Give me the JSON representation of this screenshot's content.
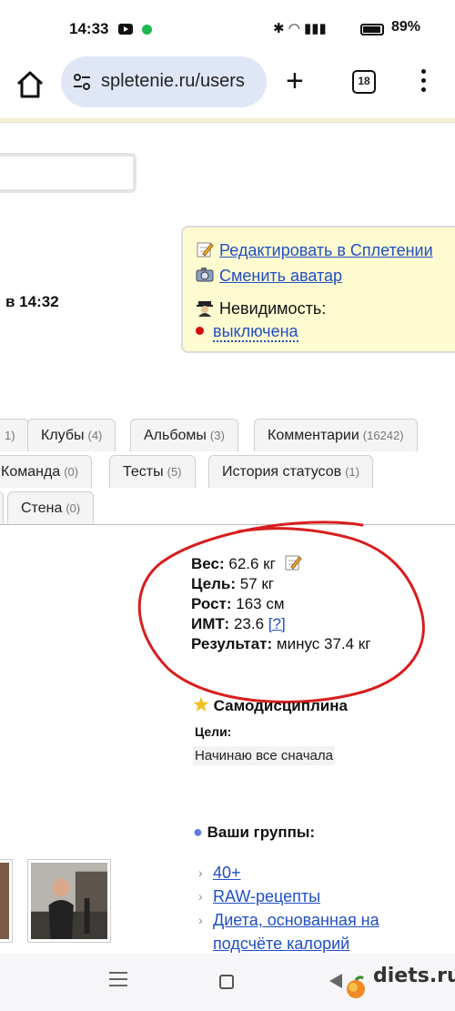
{
  "status_bar": {
    "time": "14:33",
    "battery": "89%"
  },
  "browser": {
    "url": "spletenie.ru/users",
    "tab_count": "18"
  },
  "profile": {
    "last_seen": "в 14:32",
    "actions": {
      "edit": "Редактировать в Сплетении",
      "avatar": "Сменить аватар",
      "invisibility_label": "Невидимость:",
      "invisibility_value": "выключена"
    }
  },
  "tabs": {
    "row1": [
      {
        "label": "",
        "count": "1)"
      },
      {
        "label": "Клубы",
        "count": "(4)"
      },
      {
        "label": "Альбомы",
        "count": "(3)"
      },
      {
        "label": "Комментарии",
        "count": "(16242)"
      }
    ],
    "row2": [
      {
        "label": "Команда",
        "count": "(0)"
      },
      {
        "label": "Тесты",
        "count": "(5)"
      },
      {
        "label": "История статусов",
        "count": "(1)"
      }
    ],
    "row3": [
      {
        "label": "Стена",
        "count": "(0)"
      }
    ]
  },
  "stats": {
    "weight_label": "Вес:",
    "weight": "62.6 кг",
    "goal_label": "Цель:",
    "goal": "57 кг",
    "height_label": "Рост:",
    "height": "163 см",
    "bmi_label": "ИМТ:",
    "bmi": "23.6",
    "bmi_help": "[?]",
    "result_label": "Результат:",
    "result": "минус 37.4 кг"
  },
  "discipline": {
    "title": "Самодисциплина",
    "goals_label": "Цели:",
    "goals_text": "Начинаю все сначала"
  },
  "groups": {
    "title": "Ваши группы:",
    "items": [
      "40+",
      "RAW-рецепты",
      "Диета, основанная на",
      "подсчёте калорий"
    ]
  },
  "watermark": "diets.ru",
  "colors": {
    "link": "#1f4fc6",
    "annotation_red": "#d81d1d",
    "box_bg": "#fffbd0"
  }
}
